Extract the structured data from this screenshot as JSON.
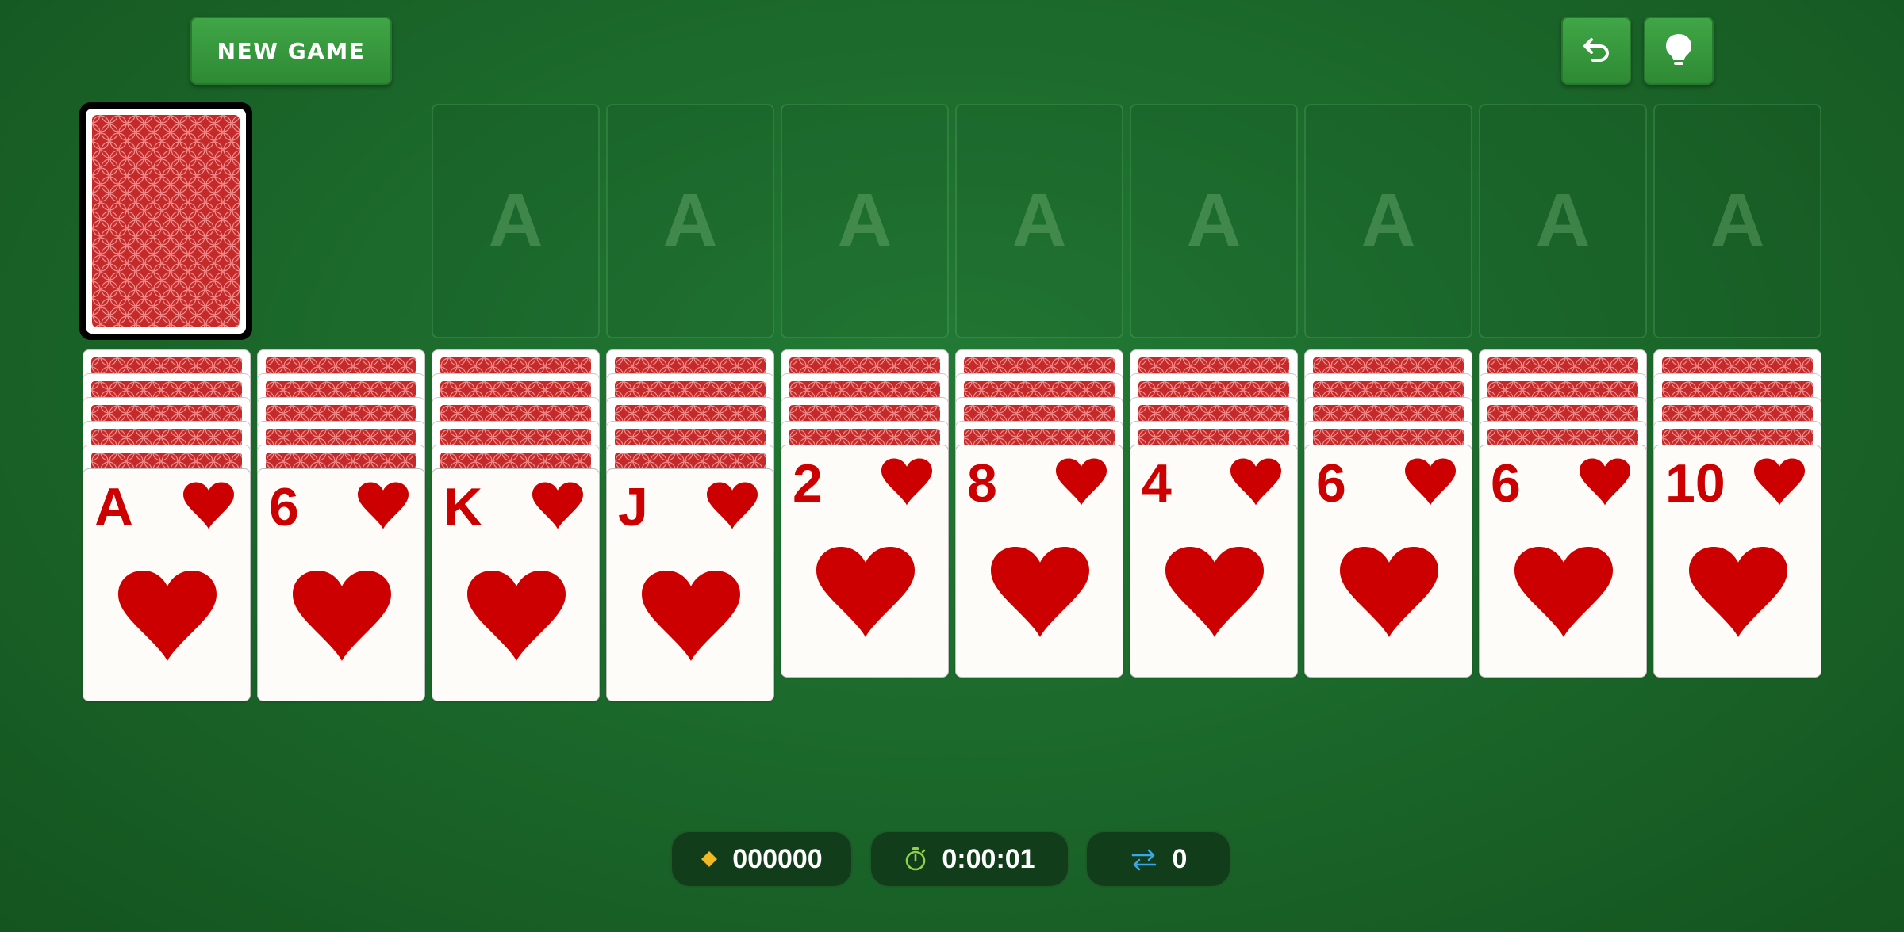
{
  "toolbar": {
    "new_game_label": "NEW GAME",
    "undo_icon": "undo-arrow-icon",
    "hint_icon": "lightbulb-icon"
  },
  "stock": {
    "card_back": "red-lattice-pattern"
  },
  "foundations": {
    "placeholder": "A",
    "count": 8,
    "labels": [
      "A",
      "A",
      "A",
      "A",
      "A",
      "A",
      "A",
      "A"
    ]
  },
  "tableau": [
    {
      "face_down": 5,
      "top": {
        "rank": "A",
        "suit": "hearts"
      }
    },
    {
      "face_down": 5,
      "top": {
        "rank": "6",
        "suit": "hearts"
      }
    },
    {
      "face_down": 5,
      "top": {
        "rank": "K",
        "suit": "hearts"
      }
    },
    {
      "face_down": 5,
      "top": {
        "rank": "J",
        "suit": "hearts"
      }
    },
    {
      "face_down": 4,
      "top": {
        "rank": "2",
        "suit": "hearts"
      }
    },
    {
      "face_down": 4,
      "top": {
        "rank": "8",
        "suit": "hearts"
      }
    },
    {
      "face_down": 4,
      "top": {
        "rank": "4",
        "suit": "hearts"
      }
    },
    {
      "face_down": 4,
      "top": {
        "rank": "6",
        "suit": "hearts"
      }
    },
    {
      "face_down": 4,
      "top": {
        "rank": "6",
        "suit": "hearts"
      }
    },
    {
      "face_down": 4,
      "top": {
        "rank": "10",
        "suit": "hearts"
      }
    }
  ],
  "status": {
    "score": "000000",
    "time": "0:00:01",
    "moves": "0"
  },
  "colors": {
    "felt": "#1c6a2c",
    "suit_red": "#cc0000",
    "card_back_red": "#c42a2a",
    "score_icon": "#f2b824",
    "timer_icon": "#8fd24a",
    "moves_icon": "#3aa8e8"
  }
}
